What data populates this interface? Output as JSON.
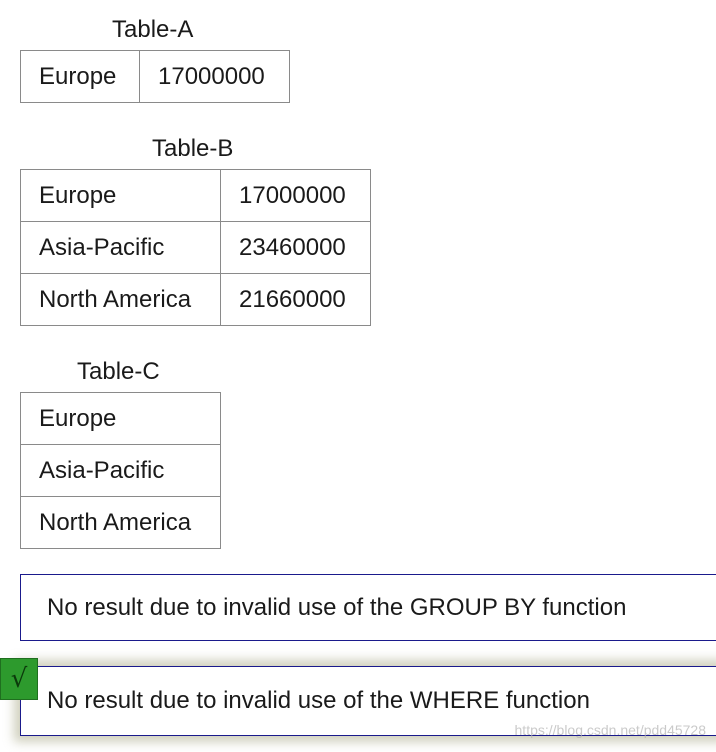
{
  "table_a": {
    "caption": "Table-A",
    "rows": [
      [
        "Europe",
        "17000000"
      ]
    ]
  },
  "table_b": {
    "caption": "Table-B",
    "rows": [
      [
        "Europe",
        "17000000"
      ],
      [
        "Asia-Pacific",
        "23460000"
      ],
      [
        "North America",
        "21660000"
      ]
    ]
  },
  "table_c": {
    "caption": "Table-C",
    "rows": [
      [
        "Europe"
      ],
      [
        "Asia-Pacific"
      ],
      [
        "North America"
      ]
    ]
  },
  "answers": [
    {
      "text": "No result due to invalid use of the GROUP BY function",
      "selected": false
    },
    {
      "text": "No result due to invalid use of the WHERE function",
      "selected": true
    }
  ],
  "check_glyph": "√",
  "watermark": "https://blog.csdn.net/pdd45728",
  "colors": {
    "check_bg": "#2d9a2d",
    "answer_border": "#1a1a8c"
  }
}
